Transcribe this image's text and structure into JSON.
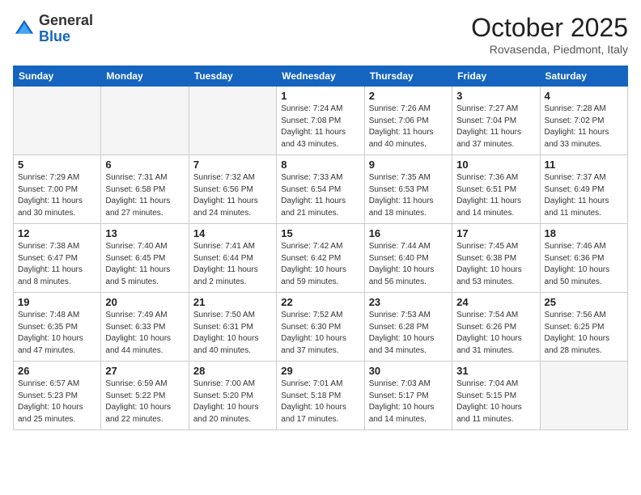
{
  "header": {
    "logo_line1": "General",
    "logo_line2": "Blue",
    "month": "October 2025",
    "location": "Rovasenda, Piedmont, Italy"
  },
  "weekdays": [
    "Sunday",
    "Monday",
    "Tuesday",
    "Wednesday",
    "Thursday",
    "Friday",
    "Saturday"
  ],
  "weeks": [
    [
      {
        "day": "",
        "info": ""
      },
      {
        "day": "",
        "info": ""
      },
      {
        "day": "",
        "info": ""
      },
      {
        "day": "1",
        "info": "Sunrise: 7:24 AM\nSunset: 7:08 PM\nDaylight: 11 hours\nand 43 minutes."
      },
      {
        "day": "2",
        "info": "Sunrise: 7:26 AM\nSunset: 7:06 PM\nDaylight: 11 hours\nand 40 minutes."
      },
      {
        "day": "3",
        "info": "Sunrise: 7:27 AM\nSunset: 7:04 PM\nDaylight: 11 hours\nand 37 minutes."
      },
      {
        "day": "4",
        "info": "Sunrise: 7:28 AM\nSunset: 7:02 PM\nDaylight: 11 hours\nand 33 minutes."
      }
    ],
    [
      {
        "day": "5",
        "info": "Sunrise: 7:29 AM\nSunset: 7:00 PM\nDaylight: 11 hours\nand 30 minutes."
      },
      {
        "day": "6",
        "info": "Sunrise: 7:31 AM\nSunset: 6:58 PM\nDaylight: 11 hours\nand 27 minutes."
      },
      {
        "day": "7",
        "info": "Sunrise: 7:32 AM\nSunset: 6:56 PM\nDaylight: 11 hours\nand 24 minutes."
      },
      {
        "day": "8",
        "info": "Sunrise: 7:33 AM\nSunset: 6:54 PM\nDaylight: 11 hours\nand 21 minutes."
      },
      {
        "day": "9",
        "info": "Sunrise: 7:35 AM\nSunset: 6:53 PM\nDaylight: 11 hours\nand 18 minutes."
      },
      {
        "day": "10",
        "info": "Sunrise: 7:36 AM\nSunset: 6:51 PM\nDaylight: 11 hours\nand 14 minutes."
      },
      {
        "day": "11",
        "info": "Sunrise: 7:37 AM\nSunset: 6:49 PM\nDaylight: 11 hours\nand 11 minutes."
      }
    ],
    [
      {
        "day": "12",
        "info": "Sunrise: 7:38 AM\nSunset: 6:47 PM\nDaylight: 11 hours\nand 8 minutes."
      },
      {
        "day": "13",
        "info": "Sunrise: 7:40 AM\nSunset: 6:45 PM\nDaylight: 11 hours\nand 5 minutes."
      },
      {
        "day": "14",
        "info": "Sunrise: 7:41 AM\nSunset: 6:44 PM\nDaylight: 11 hours\nand 2 minutes."
      },
      {
        "day": "15",
        "info": "Sunrise: 7:42 AM\nSunset: 6:42 PM\nDaylight: 10 hours\nand 59 minutes."
      },
      {
        "day": "16",
        "info": "Sunrise: 7:44 AM\nSunset: 6:40 PM\nDaylight: 10 hours\nand 56 minutes."
      },
      {
        "day": "17",
        "info": "Sunrise: 7:45 AM\nSunset: 6:38 PM\nDaylight: 10 hours\nand 53 minutes."
      },
      {
        "day": "18",
        "info": "Sunrise: 7:46 AM\nSunset: 6:36 PM\nDaylight: 10 hours\nand 50 minutes."
      }
    ],
    [
      {
        "day": "19",
        "info": "Sunrise: 7:48 AM\nSunset: 6:35 PM\nDaylight: 10 hours\nand 47 minutes."
      },
      {
        "day": "20",
        "info": "Sunrise: 7:49 AM\nSunset: 6:33 PM\nDaylight: 10 hours\nand 44 minutes."
      },
      {
        "day": "21",
        "info": "Sunrise: 7:50 AM\nSunset: 6:31 PM\nDaylight: 10 hours\nand 40 minutes."
      },
      {
        "day": "22",
        "info": "Sunrise: 7:52 AM\nSunset: 6:30 PM\nDaylight: 10 hours\nand 37 minutes."
      },
      {
        "day": "23",
        "info": "Sunrise: 7:53 AM\nSunset: 6:28 PM\nDaylight: 10 hours\nand 34 minutes."
      },
      {
        "day": "24",
        "info": "Sunrise: 7:54 AM\nSunset: 6:26 PM\nDaylight: 10 hours\nand 31 minutes."
      },
      {
        "day": "25",
        "info": "Sunrise: 7:56 AM\nSunset: 6:25 PM\nDaylight: 10 hours\nand 28 minutes."
      }
    ],
    [
      {
        "day": "26",
        "info": "Sunrise: 6:57 AM\nSunset: 5:23 PM\nDaylight: 10 hours\nand 25 minutes."
      },
      {
        "day": "27",
        "info": "Sunrise: 6:59 AM\nSunset: 5:22 PM\nDaylight: 10 hours\nand 22 minutes."
      },
      {
        "day": "28",
        "info": "Sunrise: 7:00 AM\nSunset: 5:20 PM\nDaylight: 10 hours\nand 20 minutes."
      },
      {
        "day": "29",
        "info": "Sunrise: 7:01 AM\nSunset: 5:18 PM\nDaylight: 10 hours\nand 17 minutes."
      },
      {
        "day": "30",
        "info": "Sunrise: 7:03 AM\nSunset: 5:17 PM\nDaylight: 10 hours\nand 14 minutes."
      },
      {
        "day": "31",
        "info": "Sunrise: 7:04 AM\nSunset: 5:15 PM\nDaylight: 10 hours\nand 11 minutes."
      },
      {
        "day": "",
        "info": ""
      }
    ]
  ]
}
